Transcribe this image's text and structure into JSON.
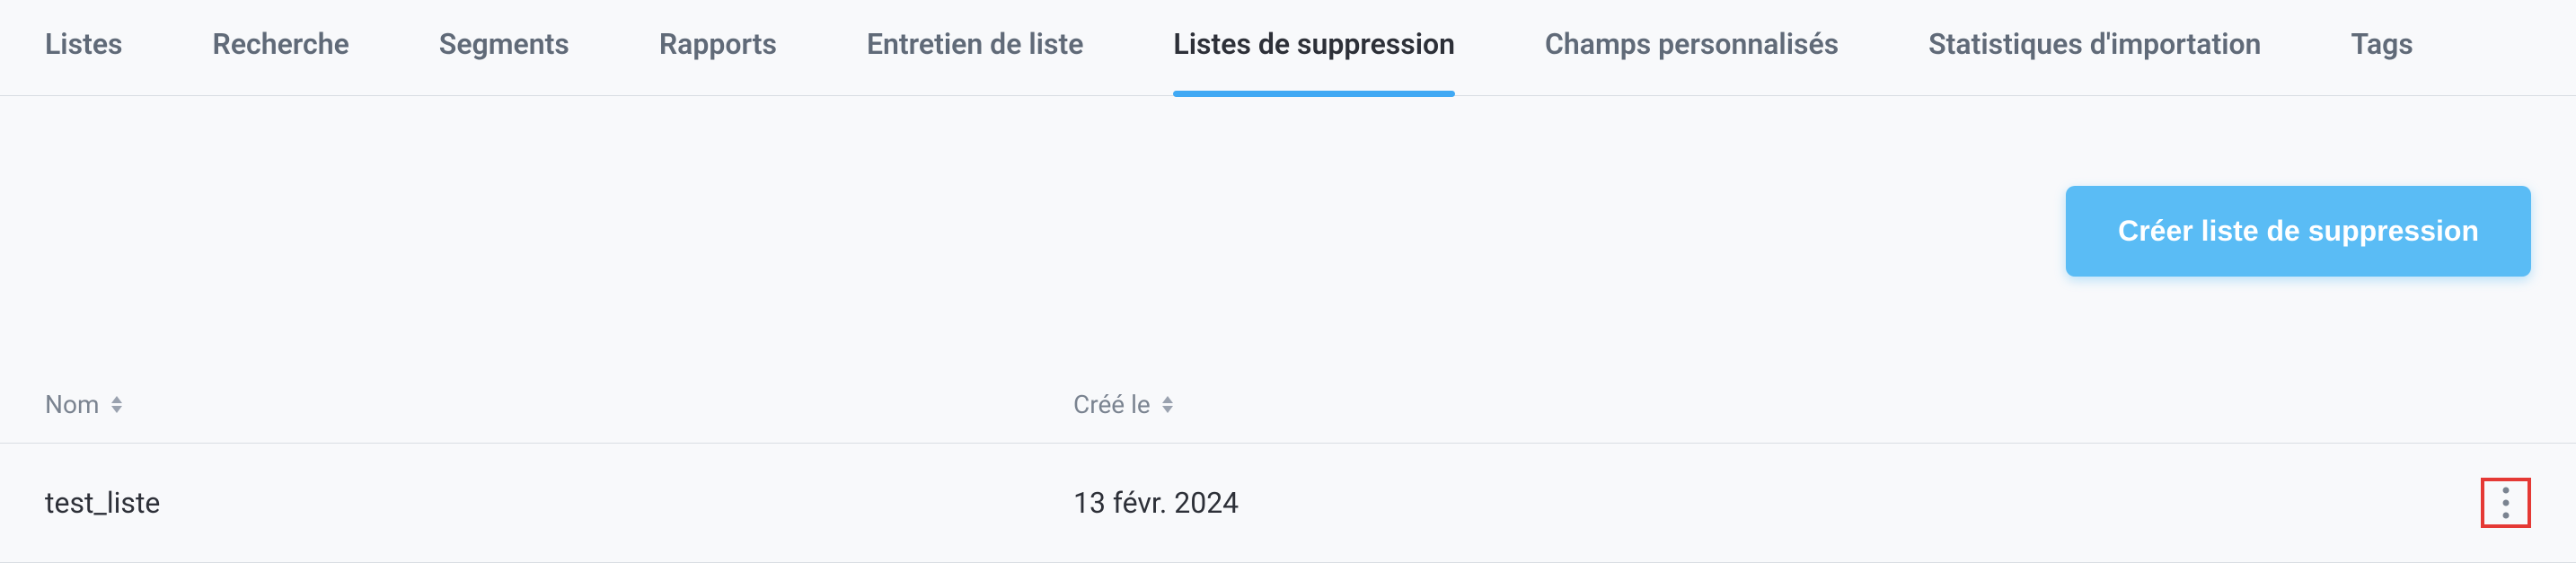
{
  "tabs": [
    {
      "label": "Listes",
      "active": false
    },
    {
      "label": "Recherche",
      "active": false
    },
    {
      "label": "Segments",
      "active": false
    },
    {
      "label": "Rapports",
      "active": false
    },
    {
      "label": "Entretien de liste",
      "active": false
    },
    {
      "label": "Listes de suppression",
      "active": true
    },
    {
      "label": "Champs personnalisés",
      "active": false
    },
    {
      "label": "Statistiques d'importation",
      "active": false
    },
    {
      "label": "Tags",
      "active": false
    }
  ],
  "actions": {
    "create_label": "Créer liste de suppression"
  },
  "table": {
    "headers": {
      "name": "Nom",
      "created": "Créé le"
    },
    "rows": [
      {
        "name": "test_liste",
        "created": "13 févr. 2024"
      }
    ]
  }
}
